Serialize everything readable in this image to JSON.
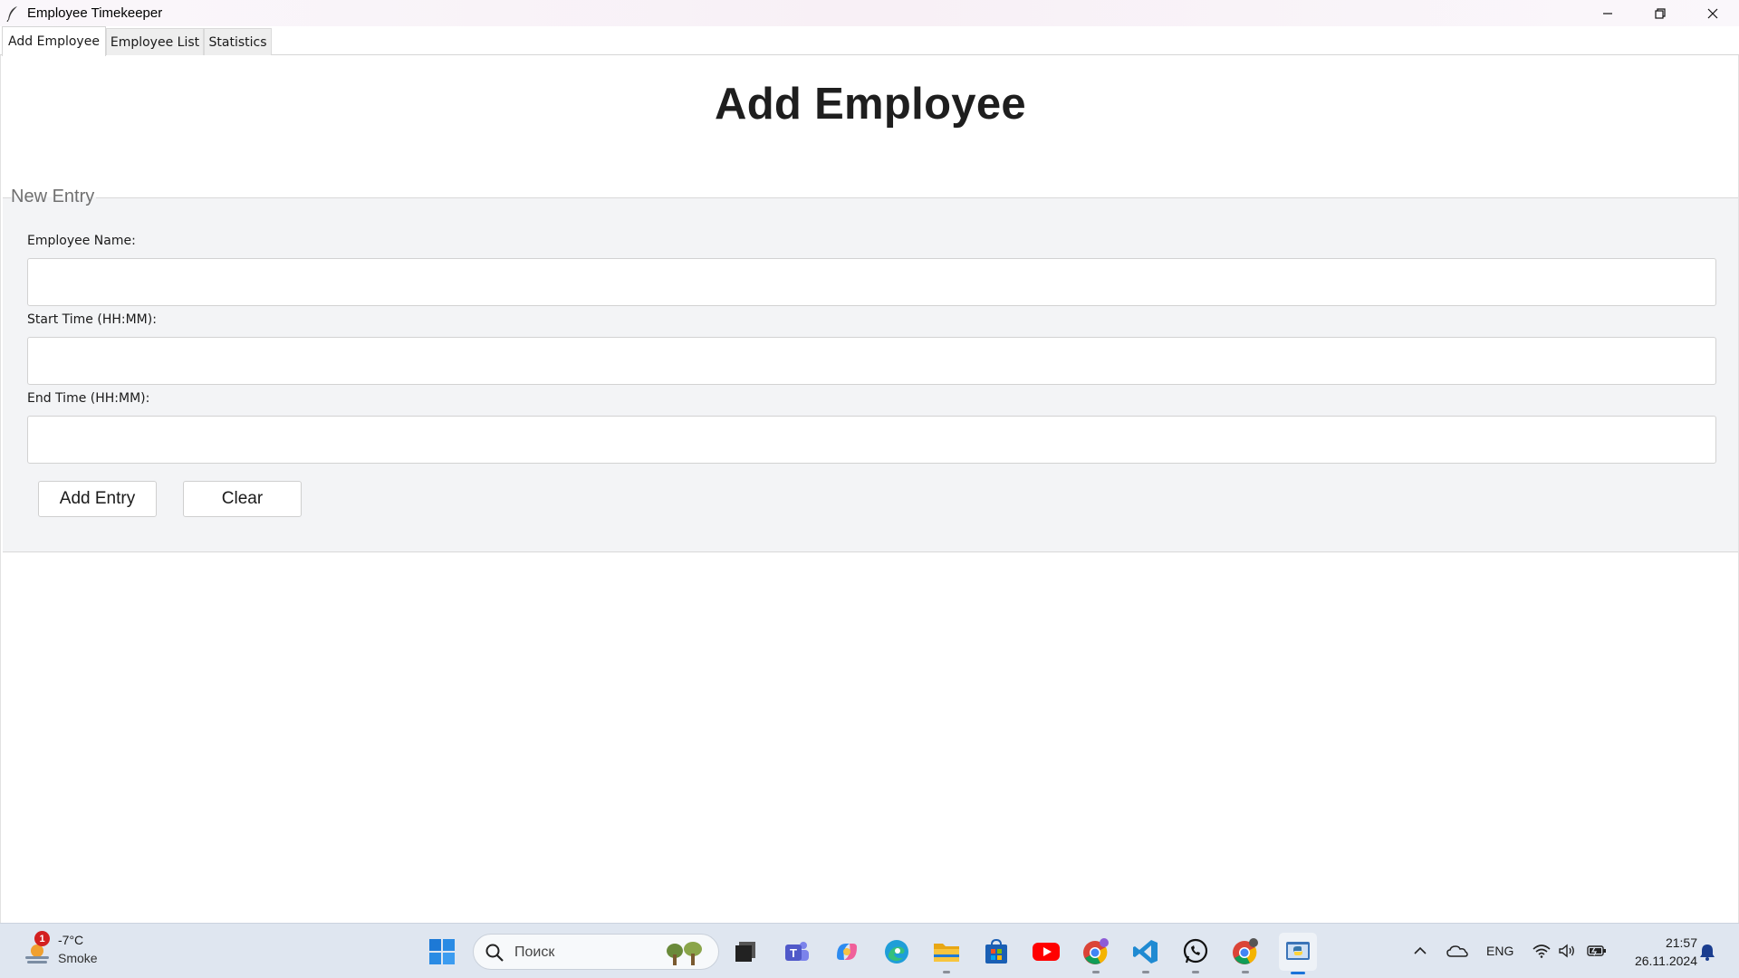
{
  "window": {
    "title": "Employee Timekeeper",
    "icon": "feather-icon",
    "controls": [
      "minimize-icon",
      "restore-icon",
      "close-icon"
    ]
  },
  "tabs": [
    {
      "label": "Add Employee",
      "active": true
    },
    {
      "label": "Employee List",
      "active": false
    },
    {
      "label": "Statistics",
      "active": false
    }
  ],
  "main": {
    "title": "Add Employee",
    "group_title": "New Entry",
    "fields": [
      {
        "label": "Employee Name:",
        "value": "",
        "placeholder": ""
      },
      {
        "label": "Start Time (HH:MM):",
        "value": "",
        "placeholder": ""
      },
      {
        "label": "End Time (HH:MM):",
        "value": "",
        "placeholder": ""
      }
    ],
    "buttons": {
      "add": "Add Entry",
      "clear": "Clear"
    }
  },
  "taskbar": {
    "weather": {
      "badge": "1",
      "temp": "-7°C",
      "desc": "Smoke"
    },
    "search_label": "Поиск",
    "apps": [
      "windows-start-icon",
      "search-icon",
      "task-view-icon",
      "teams-icon",
      "copilot-icon",
      "edge-icon",
      "file-explorer-icon",
      "microsoft-store-icon",
      "youtube-icon",
      "chrome-icon",
      "vscode-icon",
      "whatsapp-icon",
      "chrome-profile-icon",
      "python-app-icon"
    ],
    "language": "ENG",
    "time": "21:57",
    "date": "26.11.2024"
  },
  "colors": {
    "accent": "#1a73d9",
    "group_background": "#f3f4f6",
    "taskbar_background": "#dfe6f0"
  }
}
